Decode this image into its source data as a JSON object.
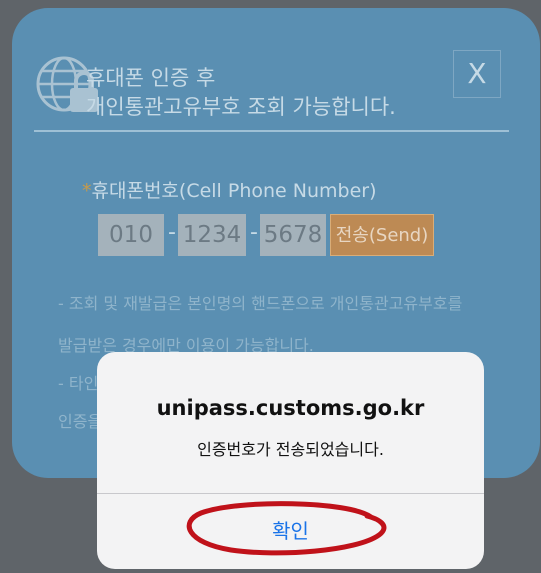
{
  "panel": {
    "title": "휴대폰 인증 후\n개인통관고유부호 조회 가능합니다.",
    "close_label": "X",
    "phone": {
      "required_mark": "*",
      "label": "휴대폰번호(Cell Phone Number)",
      "part1": "010",
      "part2": "1234",
      "part3": "5678",
      "dash": "-",
      "send_label": "전송(Send)"
    },
    "notes": [
      "- 조회 및 재발급은 본인명의 핸드폰으로 개인통관고유부호를",
      "발급받은 경우에만 이용이 가능합니다.",
      "- 타인",
      "인증을"
    ]
  },
  "dialog": {
    "title": "unipass.customs.go.kr",
    "message": "인증번호가 전송되었습니다.",
    "confirm_label": "확인"
  },
  "colors": {
    "panel_bg": "#5a8fb2",
    "send_button": "#bd8a54",
    "dialog_link": "#1a73e8",
    "annotation_circle": "#c0121a"
  }
}
